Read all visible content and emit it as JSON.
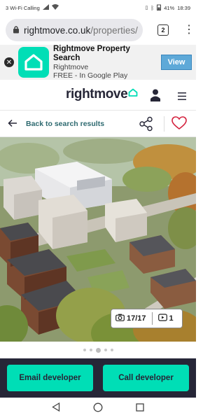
{
  "status_bar": {
    "carrier": "3 Wi-Fi Calling",
    "battery": "41%",
    "time": "18:39"
  },
  "browser": {
    "url_domain": "rightmove.co.uk",
    "url_path": "/properties/",
    "tab_count": "2"
  },
  "app_banner": {
    "title": "Rightmove Property Search",
    "publisher": "Rightmove",
    "price_line": "FREE - In Google Play",
    "view_label": "View"
  },
  "site_header": {
    "logo_text": "rightmove"
  },
  "back_bar": {
    "back_label": "Back to search results"
  },
  "gallery": {
    "photo_count": "17/17",
    "video_count": "1",
    "dots": [
      false,
      false,
      true,
      false,
      false
    ]
  },
  "cta": {
    "email_label": "Email developer",
    "call_label": "Call developer"
  },
  "colors": {
    "brand_teal": "#00deb6",
    "brand_navy": "#262637",
    "heart_red": "#d4213d"
  }
}
